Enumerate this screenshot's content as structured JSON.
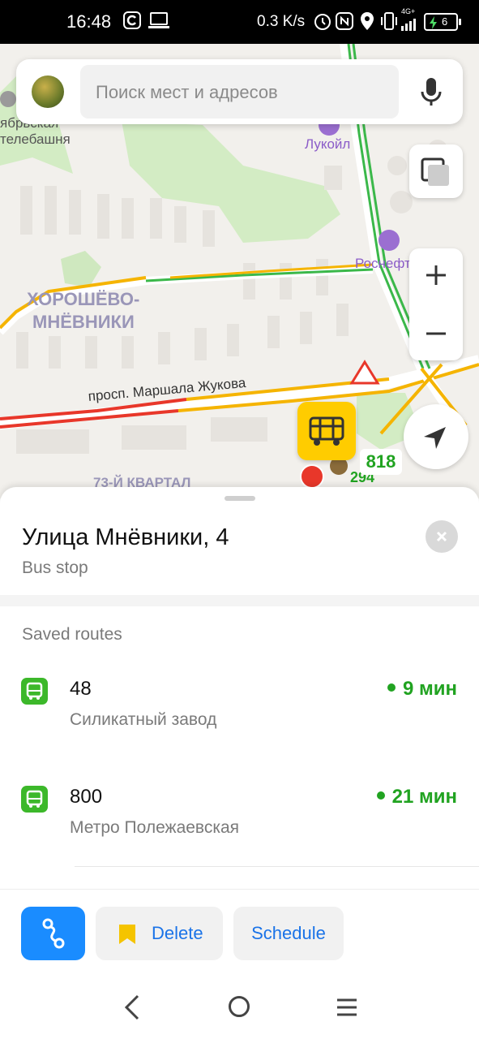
{
  "status_bar": {
    "time": "16:48",
    "net_speed": "0.3 K/s",
    "network_type": "4G+",
    "battery": "6"
  },
  "map": {
    "search_placeholder": "Поиск мест и адресов",
    "labels": {
      "tv_tower_1": "ябрьская",
      "tv_tower_2": "телебашня",
      "lukoil": "Лукойл",
      "rosneft": "Роснефть",
      "district_1": "ХОРОШЁВО-",
      "district_2": "МНЁВНИКИ",
      "street": "просп. Маршала Жукова",
      "quarter": "73-Й КВАРТАЛ",
      "route_818": "818",
      "route_294": "294"
    }
  },
  "sheet": {
    "title": "Улица Мнёвники, 4",
    "subtitle": "Bus stop",
    "saved_routes_label": "Saved routes",
    "routes": [
      {
        "number": "48",
        "destination": "Силикатный завод",
        "eta": "9 мин"
      },
      {
        "number": "800",
        "destination": "Метро Полежаевская",
        "eta": "21 мин"
      }
    ],
    "actions": {
      "delete_label": "Delete",
      "schedule_label": "Schedule"
    }
  },
  "colors": {
    "accent_blue": "#1a8cff",
    "link_blue": "#1a73e8",
    "route_green": "#3cb82a",
    "eta_green": "#21a321",
    "bus_pin_yellow": "#ffcc00"
  }
}
